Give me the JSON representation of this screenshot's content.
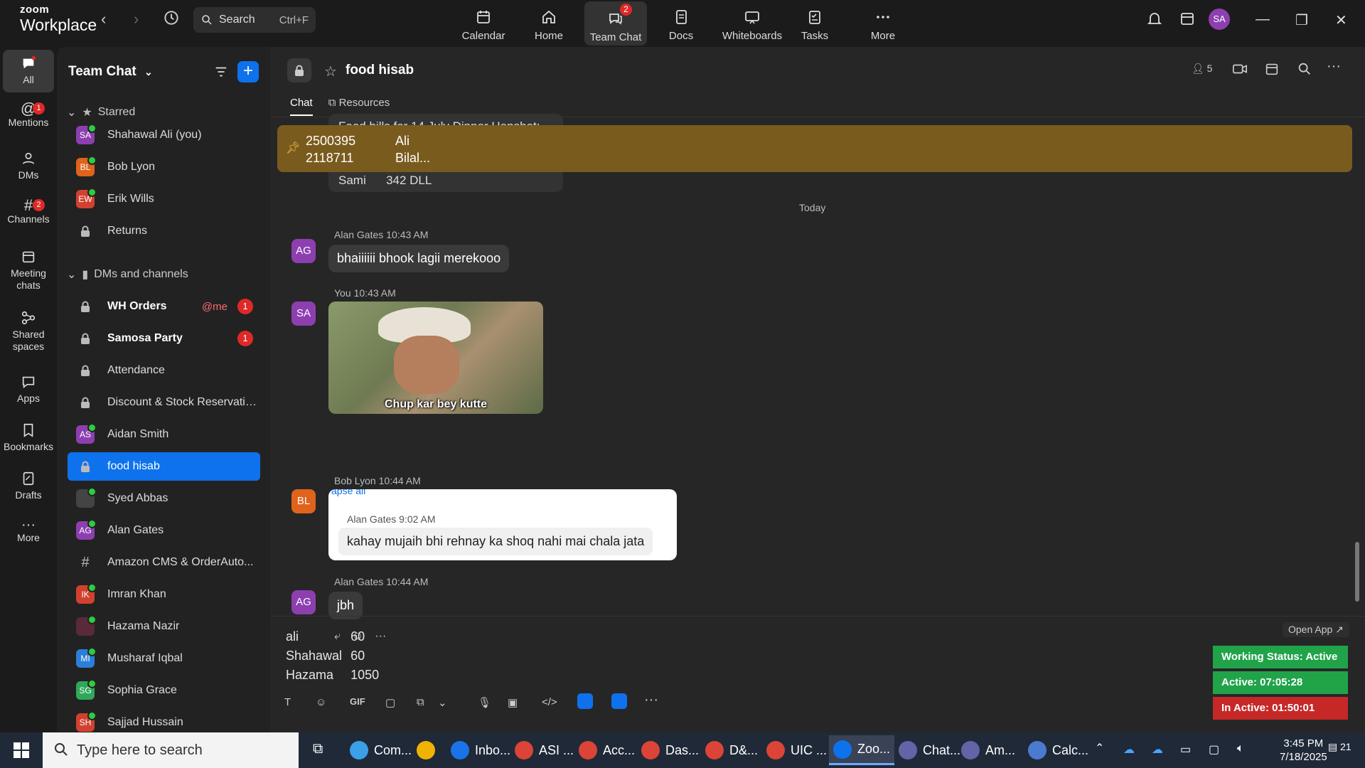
{
  "topbar": {
    "logo_small": "zoom",
    "logo_big": "Workplace",
    "search_label": "Search",
    "search_shortcut": "Ctrl+F",
    "nav": [
      {
        "label": "Calendar"
      },
      {
        "label": "Home"
      },
      {
        "label": "Team Chat",
        "badge": "2"
      },
      {
        "label": "Docs"
      },
      {
        "label": "Whiteboards"
      },
      {
        "label": "Tasks"
      },
      {
        "label": "More"
      }
    ],
    "avatar": "SA"
  },
  "rail": [
    {
      "label": "All"
    },
    {
      "label": "Mentions",
      "badge": "1"
    },
    {
      "label": "DMs"
    },
    {
      "label": "Channels",
      "badge": "2"
    },
    {
      "label": "Meeting chats"
    },
    {
      "label": "Shared spaces"
    },
    {
      "label": "Apps"
    },
    {
      "label": "Bookmarks"
    },
    {
      "label": "Drafts"
    },
    {
      "label": "More"
    }
  ],
  "panel": {
    "title": "Team Chat",
    "starred": "Starred",
    "dms_channels": "DMs and channels",
    "starred_items": [
      {
        "initials": "SA",
        "name": "Shahawal Ali (you)",
        "color": "#8d3fb0"
      },
      {
        "initials": "BL",
        "name": "Bob Lyon",
        "color": "#e0631b"
      },
      {
        "initials": "EW",
        "name": "Erik Wills",
        "color": "#d2412f"
      },
      {
        "initials": "",
        "name": "Returns",
        "color": ""
      }
    ],
    "items": [
      {
        "type": "lock",
        "name": "WH Orders",
        "bold": true,
        "mention": "@me",
        "count": "1"
      },
      {
        "type": "lock",
        "name": "Samosa Party",
        "bold": true,
        "count": "1"
      },
      {
        "type": "lock",
        "name": "Attendance"
      },
      {
        "type": "lock",
        "name": "Discount & Stock Reservatio..."
      },
      {
        "type": "avatar",
        "initials": "AS",
        "name": "Aidan Smith",
        "color": "#8d3fb0"
      },
      {
        "type": "lock",
        "name": "food hisab",
        "selected": true
      },
      {
        "type": "avatar",
        "initials": "",
        "name": "Syed Abbas",
        "color": "#444444"
      },
      {
        "type": "avatar",
        "initials": "AG",
        "name": "Alan Gates",
        "color": "#8d3fb0"
      },
      {
        "type": "hash",
        "name": "Amazon CMS & OrderAuto..."
      },
      {
        "type": "avatar",
        "initials": "IK",
        "name": "Imran Khan",
        "color": "#d2412f"
      },
      {
        "type": "avatar",
        "initials": "",
        "name": "Hazama Nazir",
        "color": "#5a2a3a"
      },
      {
        "type": "avatar",
        "initials": "MI",
        "name": "Musharaf Iqbal",
        "color": "#2b7fd8"
      },
      {
        "type": "avatar",
        "initials": "SG",
        "name": "Sophia Grace",
        "color": "#2fa85a"
      },
      {
        "type": "avatar",
        "initials": "SH",
        "name": "Sajjad Hussain",
        "color": "#d2412f"
      }
    ]
  },
  "chat": {
    "title": "food hisab",
    "members": "5",
    "tabs": [
      "Chat",
      "Resources"
    ],
    "prev_fragment": "Food bills for 14 July Dinner Hanshat:",
    "prev_fragment2": "Sami      342 DLL",
    "pinned": [
      {
        "a": "2500395",
        "b": "Ali"
      },
      {
        "a": "2118711",
        "b": "Bilal..."
      }
    ],
    "today": "Today",
    "messages": [
      {
        "author": "Alan Gates",
        "time": "10:43 AM",
        "initials": "AG",
        "text": "bhaiiiiii bhook lagii merekooo"
      },
      {
        "author": "You",
        "time": "10:43 AM",
        "initials": "SA",
        "image_caption": "Chup kar bey kutte"
      },
      {
        "author": "Bob Lyon",
        "time": "10:44 AM",
        "initials": "BL",
        "reply_header": "apse all",
        "quoted_author": "Alan Gates",
        "quoted_time": "9:02 AM",
        "quoted_text": "kahay mujaih bhi rehnay ka shoq nahi mai chala jata"
      },
      {
        "author": "Alan Gates",
        "time": "10:44 AM",
        "initials": "AG",
        "text": "jbh"
      }
    ],
    "draft": [
      {
        "name": "ali",
        "value": "60"
      },
      {
        "name": "Shahawal",
        "value": "60"
      },
      {
        "name": "Hazama",
        "value": "1050"
      }
    ],
    "open_app": "Open App ↗",
    "gif": "GIF"
  },
  "widgets": {
    "status": "Working Status: Active",
    "active": "Active: 07:05:28",
    "inactive": "In Active: 01:50:01",
    "colors": {
      "status": "#21a34a",
      "active": "#21a34a",
      "inactive": "#c62828"
    }
  },
  "taskbar": {
    "search": "Type here to search",
    "apps": [
      {
        "label": "Com...",
        "color": "#3aa0e8"
      },
      {
        "label": "",
        "color": "#f0b400"
      },
      {
        "label": "Inbo...",
        "color": "#1a73e8"
      },
      {
        "label": "ASI ...",
        "color": "#db4437"
      },
      {
        "label": "Acc...",
        "color": "#db4437"
      },
      {
        "label": "Das...",
        "color": "#db4437"
      },
      {
        "label": "D&...",
        "color": "#db4437"
      },
      {
        "label": "UIC ...",
        "color": "#db4437"
      },
      {
        "label": "Zoo...",
        "color": "#0e72ed"
      },
      {
        "label": "Chat...",
        "color": "#6264a7"
      },
      {
        "label": "Am...",
        "color": "#6264a7"
      },
      {
        "label": "Calc...",
        "color": "#4a7bd0"
      }
    ],
    "time": "3:45 PM",
    "date": "7/18/2025",
    "notif": "21"
  }
}
